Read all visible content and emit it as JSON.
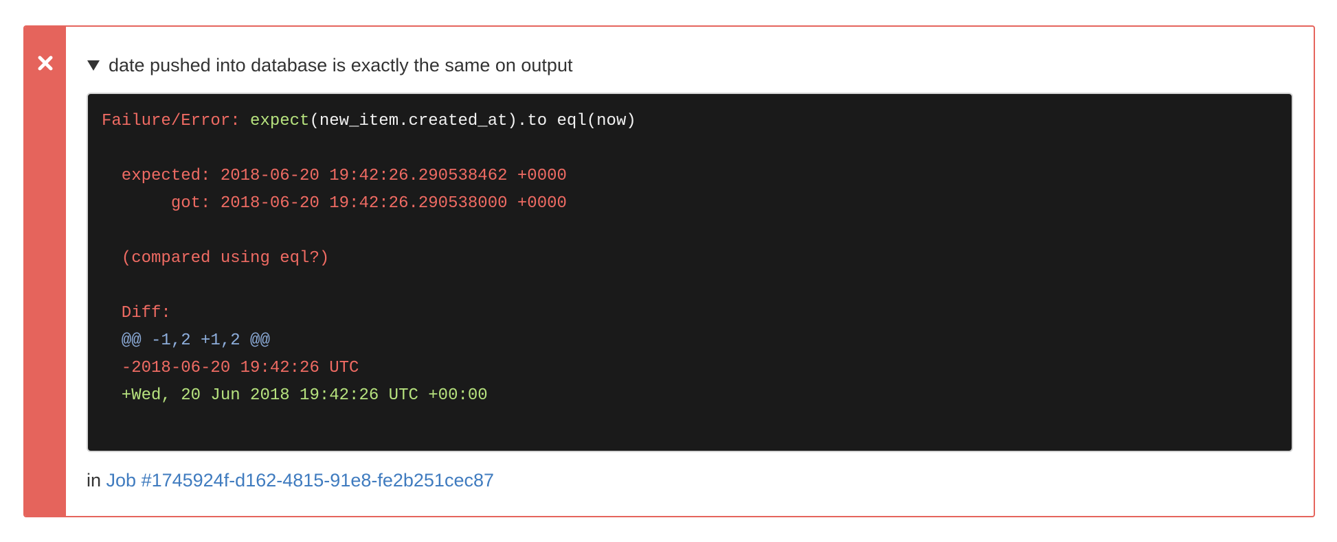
{
  "test": {
    "title": "date pushed into database is exactly the same on output",
    "footer_prefix": "in",
    "job_link": "Job #1745924f-d162-4815-91e8-fe2b251cec87"
  },
  "failure": {
    "label": "Failure/Error:",
    "call_method": "expect",
    "call_rest": "(new_item.created_at).to eql(now)",
    "expected": "  expected: 2018-06-20 19:42:26.290538462 +0000",
    "got": "       got: 2018-06-20 19:42:26.290538000 +0000",
    "compared": "  (compared using eql?)",
    "diff_label": "  Diff:",
    "diff_header": "  @@ -1,2 +1,2 @@",
    "diff_removed": "  -2018-06-20 19:42:26 UTC",
    "diff_added": "  +Wed, 20 Jun 2018 19:42:26 UTC +00:00"
  },
  "colors": {
    "failure_red": "#e5645c",
    "code_background": "#1a1a1a",
    "link_blue": "#3f7bbf"
  }
}
